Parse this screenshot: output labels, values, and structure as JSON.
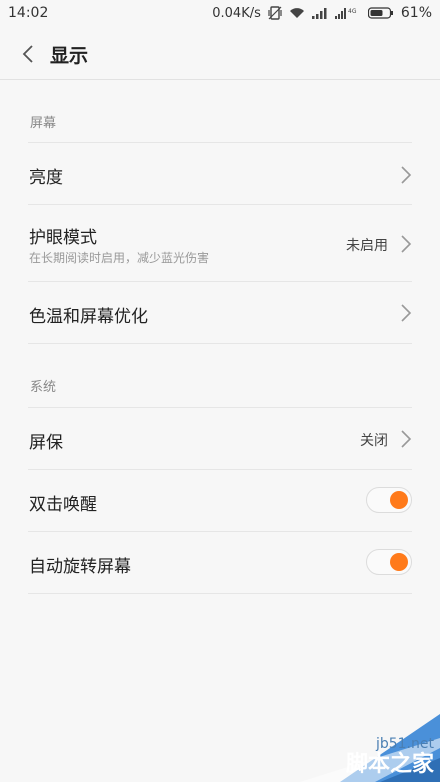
{
  "status_bar": {
    "time": "14:02",
    "net_speed": "0.04K/s",
    "network": "4G",
    "battery": "61%"
  },
  "header": {
    "title": "显示",
    "back_icon": "chevron-left-icon"
  },
  "sections": {
    "screen_label": "屏幕",
    "system_label": "系统"
  },
  "items": {
    "brightness": {
      "title": "亮度"
    },
    "eye_care": {
      "title": "护眼模式",
      "subtitle": "在长期阅读时启用，减少蓝光伤害",
      "value": "未启用"
    },
    "color_temp": {
      "title": "色温和屏幕优化"
    },
    "screensaver": {
      "title": "屏保",
      "value": "关闭"
    },
    "double_tap_wake": {
      "title": "双击唤醒",
      "enabled": true
    },
    "auto_rotate": {
      "title": "自动旋转屏幕",
      "enabled": true
    }
  },
  "colors": {
    "accent": "#ff7a1a",
    "background": "#f7f7f7"
  },
  "watermark": {
    "url": "jb51.net",
    "text": "脚本之家"
  }
}
